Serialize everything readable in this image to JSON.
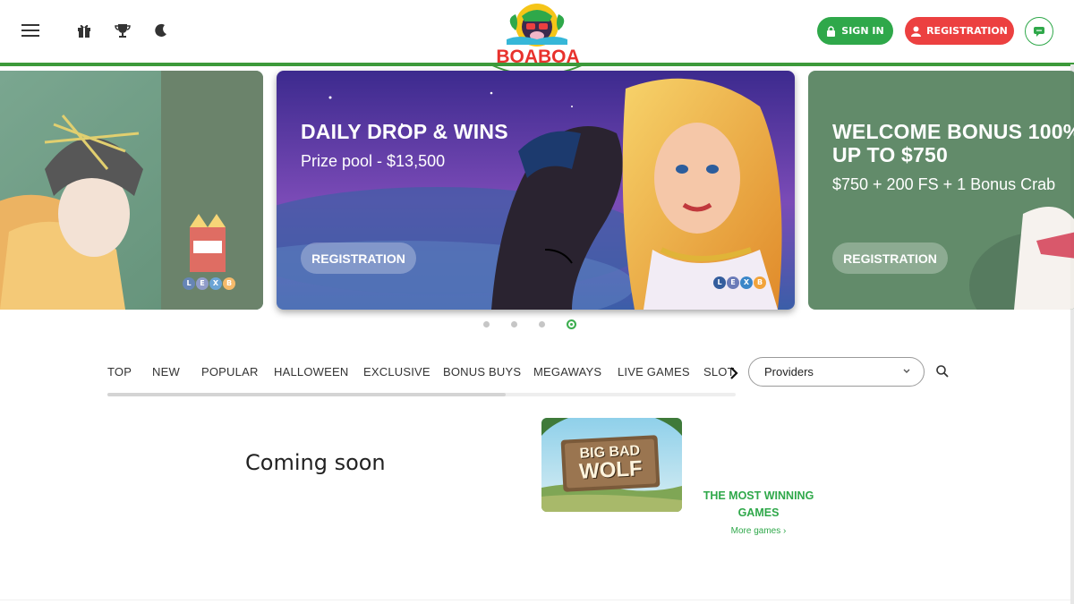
{
  "header": {
    "logo_text": "BOABOA",
    "signin_label": "SIGN IN",
    "registration_label": "REGISTRATION",
    "icons": [
      "menu-icon",
      "gift-icon",
      "trophy-icon",
      "moon-icon",
      "lock-icon",
      "user-icon",
      "chat-icon"
    ]
  },
  "banners": [
    {
      "id": "left",
      "title": "",
      "subtitle": "",
      "button": "",
      "crypto": [
        "L",
        "E",
        "X",
        "B"
      ]
    },
    {
      "id": "center",
      "title": "DAILY DROP & WINS",
      "subtitle": "Prize pool - $13,500",
      "button": "REGISTRATION",
      "crypto": [
        "L",
        "E",
        "X",
        "B"
      ]
    },
    {
      "id": "right",
      "title_line1": "WELCOME BONUS 100%",
      "title_line2": "UP TO $750",
      "subtitle": "$750 + 200 FS + 1 Bonus Crab",
      "button": "REGISTRATION"
    }
  ],
  "carousel": {
    "dots": 4,
    "active_index": 3
  },
  "tabs": [
    "TOP",
    "NEW",
    "POPULAR",
    "HALLOWEEN",
    "EXCLUSIVE",
    "BONUS BUYS",
    "MEGAWAYS",
    "LIVE GAMES",
    "SLOTS"
  ],
  "providers_label": "Providers",
  "main": {
    "coming_soon": "Coming soon",
    "game_title_line1": "BIG BAD",
    "game_title_line2": "WOLF",
    "most_winning": "THE MOST WINNING GAMES",
    "more_games": "More games"
  },
  "colors": {
    "brand_green": "#2fa84a",
    "brand_red": "#ec4040",
    "header_line": "#3c9a3a"
  }
}
